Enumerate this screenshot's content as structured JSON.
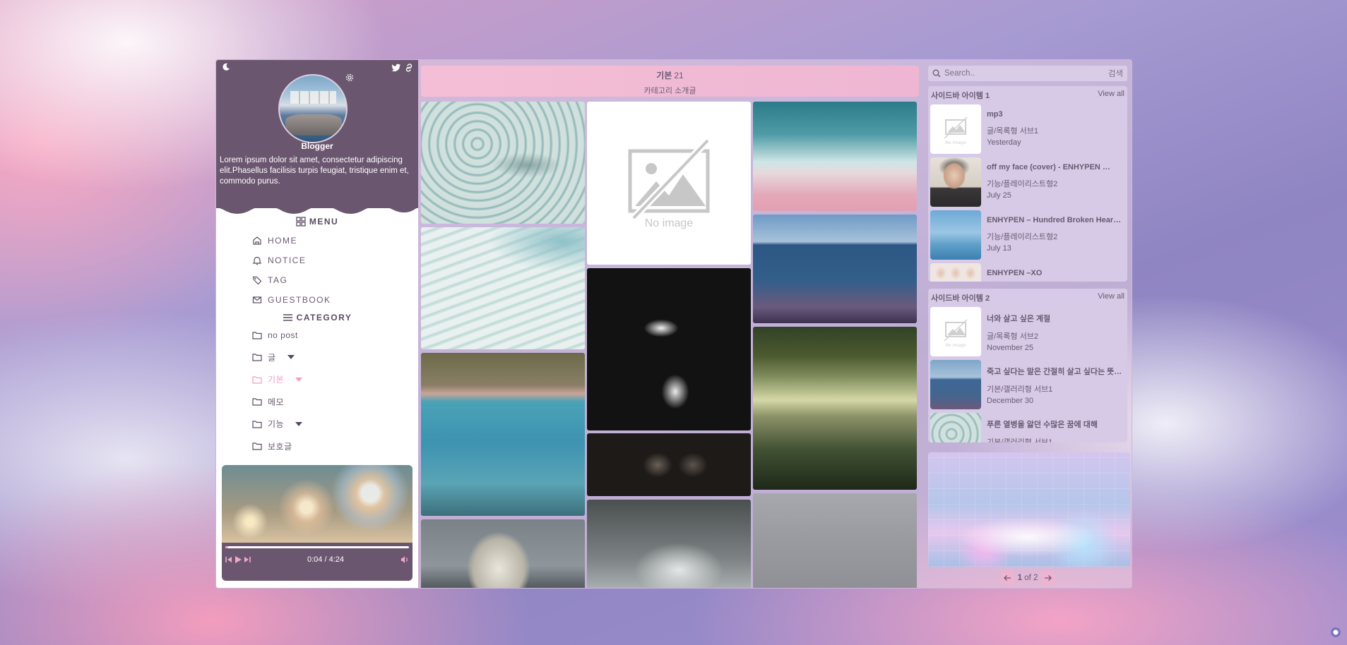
{
  "profile": {
    "name": "Blogger",
    "bio": "Lorem ipsum dolor sit amet, consectetur adipiscing elit.Phasellus facilisis turpis feugiat, tristique enim et, commodo purus."
  },
  "menu": {
    "title": "MENU",
    "items": [
      {
        "label": "HOME",
        "icon": "home-icon"
      },
      {
        "label": "NOTICE",
        "icon": "bell-icon"
      },
      {
        "label": "TAG",
        "icon": "tag-icon"
      },
      {
        "label": "GUESTBOOK",
        "icon": "mail-icon"
      }
    ]
  },
  "category": {
    "title": "CATEGORY",
    "items": [
      {
        "label": "no post"
      },
      {
        "label": "글"
      },
      {
        "label": "기본"
      },
      {
        "label": "메모"
      },
      {
        "label": "기능"
      },
      {
        "label": "보호글"
      }
    ]
  },
  "player": {
    "time": "0:04 / 4:24",
    "progress": 0.015
  },
  "header": {
    "title": "기본",
    "count": "21",
    "description": "카테고리 소개글"
  },
  "gallery": {
    "no_image_label": "No image"
  },
  "search": {
    "placeholder": "Search..",
    "button": "검색"
  },
  "sidebar1": {
    "title": "사이드바 아이템 1",
    "view_all": "View all",
    "items": [
      {
        "title": "mp3",
        "sub": "글/목록형 서브1",
        "date": "Yesterday",
        "no_image": "No Image"
      },
      {
        "title": "off my face (cover) - ENHYPEN …",
        "sub": "기능/플레이리스트형2",
        "date": "July 25"
      },
      {
        "title": "ENHYPEN – Hundred Broken Hear…",
        "sub": "기능/플레이리스트형2",
        "date": "July 13"
      },
      {
        "title": "ENHYPEN –XO",
        "sub": "",
        "date": ""
      }
    ]
  },
  "sidebar2": {
    "title": "사이드바 아이템 2",
    "view_all": "View all",
    "items": [
      {
        "title": "너와 살고 싶은 계절",
        "sub": "글/목록형 서브2",
        "date": "November 25",
        "no_image": "No Image"
      },
      {
        "title": "죽고 싶다는 말은 간절히 살고 싶다는 뜻…",
        "sub": "기본/갤러리형 서브1",
        "date": "December 30"
      },
      {
        "title": "푸른 열병을 앓던 수많은 꿈에 대해",
        "sub": "기본/갤러리형 서브1",
        "date": ""
      }
    ]
  },
  "pagination": {
    "current": "1",
    "of_label": "of 2"
  }
}
